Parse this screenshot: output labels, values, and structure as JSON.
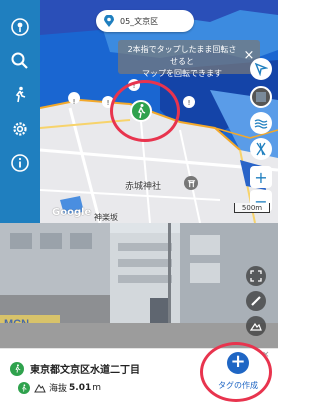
{
  "toolbar": {
    "items": [
      {
        "name": "map-pin-icon"
      },
      {
        "name": "search-icon"
      },
      {
        "name": "walker-icon"
      },
      {
        "name": "gear-icon"
      },
      {
        "name": "info-icon"
      }
    ]
  },
  "map": {
    "area_chip": "05_文京区",
    "tooltip": "2本指でタップしたまま回転させると\nマップを回転できます",
    "tooltip_close": "×",
    "place_label": "赤城神社",
    "neighborhood_label": "神楽坂",
    "google_logo": "Google",
    "scale_label": "500m",
    "controls": [
      "navigate-arrow-icon",
      "layers-icon",
      "waves-icon",
      "lightning-icon",
      "zoom-in-icon",
      "zoom-out-icon"
    ],
    "zoom_in": "+",
    "zoom_out": "−"
  },
  "street_view": {
    "controls": [
      "fullscreen-icon",
      "ruler-icon",
      "terrain-icon"
    ],
    "sign_text": "MCN"
  },
  "bottom": {
    "address": "東京都文京区水道二丁目",
    "elevation_label": "海抜",
    "elevation_value": "5.01",
    "elevation_unit": "m",
    "create_tag_label": "タグの作成",
    "create_tag_plus": "+",
    "close": "×"
  },
  "colors": {
    "toolbar": "#1f7fbf",
    "flood_blue": "#1a66d1",
    "accent_green": "#2fa24d",
    "fab_blue": "#1f66c4",
    "highlight": "#e8344e"
  }
}
